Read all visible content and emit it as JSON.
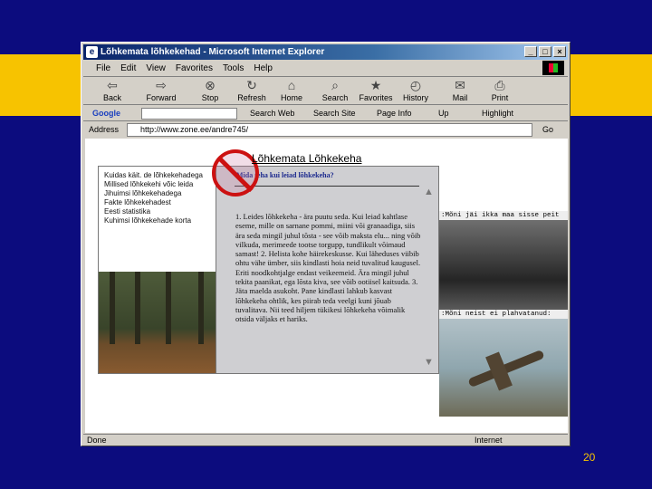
{
  "window": {
    "title": "Lõhkemata lõhkekehad - Microsoft Internet Explorer",
    "title_icon": "ie-logo-icon",
    "controls": [
      "_",
      "□",
      "×"
    ]
  },
  "menu": [
    "File",
    "Edit",
    "View",
    "Favorites",
    "Tools",
    "Help"
  ],
  "toolbar": [
    {
      "label": "Back",
      "icon": "back-arrow-icon",
      "glyph": "⇦"
    },
    {
      "label": "Forward",
      "icon": "forward-arrow-icon",
      "glyph": "⇨"
    },
    {
      "label": "Stop",
      "icon": "stop-icon",
      "glyph": "⊗"
    },
    {
      "label": "Refresh",
      "icon": "refresh-icon",
      "glyph": "↻"
    },
    {
      "label": "Home",
      "icon": "home-icon",
      "glyph": "⌂"
    },
    {
      "label": "Search",
      "icon": "search-icon",
      "glyph": "⌕"
    },
    {
      "label": "Favorites",
      "icon": "favorites-icon",
      "glyph": "★"
    },
    {
      "label": "History",
      "icon": "history-icon",
      "glyph": "◴"
    },
    {
      "label": "Mail",
      "icon": "mail-icon",
      "glyph": "✉"
    },
    {
      "label": "Print",
      "icon": "print-icon",
      "glyph": "⎙"
    }
  ],
  "googlebar": {
    "logo": "Google",
    "search_web": "Search Web",
    "search_site": "Search Site",
    "page_info": "Page Info",
    "up": "Up",
    "highlight": "Highlight"
  },
  "address": {
    "label": "Address",
    "url": "http://www.zone.ee/andre745/",
    "go": "Go"
  },
  "page": {
    "title": "Lõhkemata  Lõhkekeha",
    "sidebar_links": [
      "Kuidas käit. de lõhkekehadega",
      "Millised lõhkekehi võic leida",
      "Jihuimsi lõhkekehadega",
      "Fakte lõhkekehadest",
      "Eesti statistika",
      "Kuhimsi lõhkekehade korta"
    ],
    "center_question": "Mida teha kui leiad lõhkekeha?",
    "center_text": "1. Leides lõhkekeha - ära puutu seda. Kui leiad kahtlase eseme, mille on sarnane pommi, miini või granaadiga, siis ära seda mingil juhul tõsta - see võib maksta elu... ning võib vilkuda, merimeede tootse torgupp, tundlikult võimaud samast! 2. Helista kohe häirekeskusse. Kui läheduses viibib ohtu vähe ümber, siis kindlasti hoia neid tuvalitud kaugusel. Eriti noodkohtjalge endast veikeemeid. Ära mingil juhul tekita paanikat, ega lõsta kiva, see võib ootiisel kaitsuda. 3. Jäta maelda asukoht. Pane kindlasti lahkub kasvast lõhkekeha ohtlik, kes piirab teda veelgi kuni jõuab tuvalitava. Nii teed hiljem tükikesi lõhkekeha võimalik otsida väljaks et hariks.",
    "photo1_caption": ":Mõni jäi ikka maa sisse peit",
    "photo2_caption": ":Mõni neist ei plahvatanud:"
  },
  "status": {
    "left": "Done",
    "right": "Internet"
  },
  "slide_number": "20",
  "colors": {
    "background": "#0c0c7e",
    "band": "#f7c300",
    "titlebar": "#0a246a",
    "question": "#1c2a8e"
  }
}
